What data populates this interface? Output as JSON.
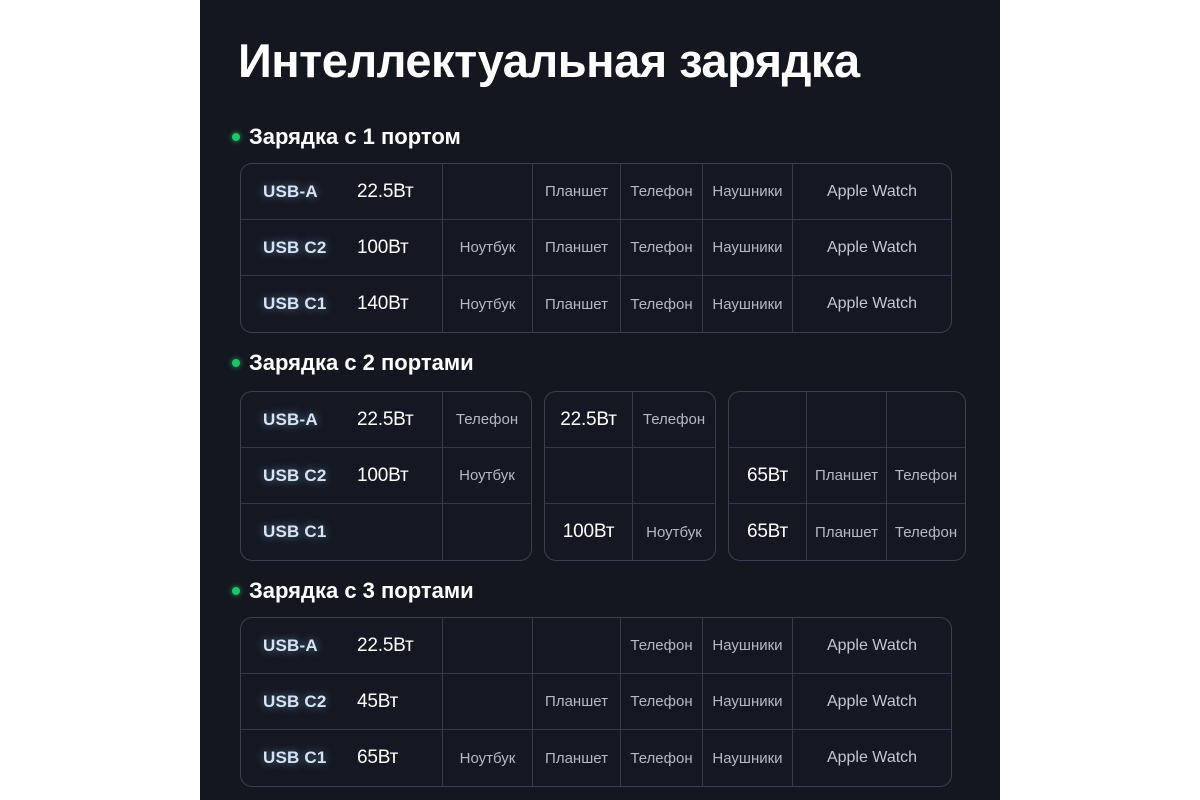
{
  "page": {
    "title": "Интеллектуальная зарядка",
    "background": "#141720",
    "panel_color": "#141720",
    "accent_color": "#1fc464",
    "port_label_color": "#d4e4f6",
    "power_text_color": "#ffffff",
    "device_text_color": "#b3b9c5"
  },
  "sections": [
    {
      "id": "one-port",
      "bullet": "bullet-dot",
      "title": "Зарядка с 1 портом",
      "blocks": [
        {
          "rows": [
            {
              "port": "USB-A",
              "power": "22.5Вт",
              "cells": [
                "",
                "Планшет",
                "Телефон",
                "Наушники",
                "Apple Watch"
              ]
            },
            {
              "port": "USB C2",
              "power": "100Вт",
              "cells": [
                "Ноутбук",
                "Планшет",
                "Телефон",
                "Наушники",
                "Apple Watch"
              ]
            },
            {
              "port": "USB C1",
              "power": "140Вт",
              "cells": [
                "Ноутбук",
                "Планшет",
                "Телефон",
                "Наушники",
                "Apple Watch"
              ]
            }
          ]
        }
      ]
    },
    {
      "id": "two-ports",
      "bullet": "bullet-dot",
      "title": "Зарядка с 2 портами",
      "blocks": [
        {
          "rows": [
            {
              "port": "USB-A",
              "power": "22.5Вт",
              "cells": [
                "Телефон"
              ]
            },
            {
              "port": "USB C2",
              "power": "100Вт",
              "cells": [
                "Ноутбук"
              ]
            },
            {
              "port": "USB C1",
              "power": "",
              "cells": [
                ""
              ]
            }
          ]
        },
        {
          "rows": [
            {
              "power": "22.5Вт",
              "cells": [
                "Телефон"
              ]
            },
            {
              "power": "",
              "cells": [
                ""
              ]
            },
            {
              "power": "100Вт",
              "cells": [
                "Ноутбук"
              ]
            }
          ]
        },
        {
          "rows": [
            {
              "power": "",
              "cells": [
                "",
                ""
              ]
            },
            {
              "power": "65Вт",
              "cells": [
                "Планшет",
                "Телефон"
              ]
            },
            {
              "power": "65Вт",
              "cells": [
                "Планшет",
                "Телефон"
              ]
            }
          ]
        }
      ]
    },
    {
      "id": "three-ports",
      "bullet": "bullet-dot",
      "title": "Зарядка с 3 портами",
      "blocks": [
        {
          "rows": [
            {
              "port": "USB-A",
              "power": "22.5Вт",
              "cells": [
                "",
                "",
                "Телефон",
                "Наушники",
                "Apple Watch"
              ]
            },
            {
              "port": "USB C2",
              "power": "45Вт",
              "cells": [
                "",
                "Планшет",
                "Телефон",
                "Наушники",
                "Apple Watch"
              ]
            },
            {
              "port": "USB C1",
              "power": "65Вт",
              "cells": [
                "Ноутбук",
                "Планшет",
                "Телефон",
                "Наушники",
                "Apple Watch"
              ]
            }
          ]
        }
      ]
    }
  ]
}
